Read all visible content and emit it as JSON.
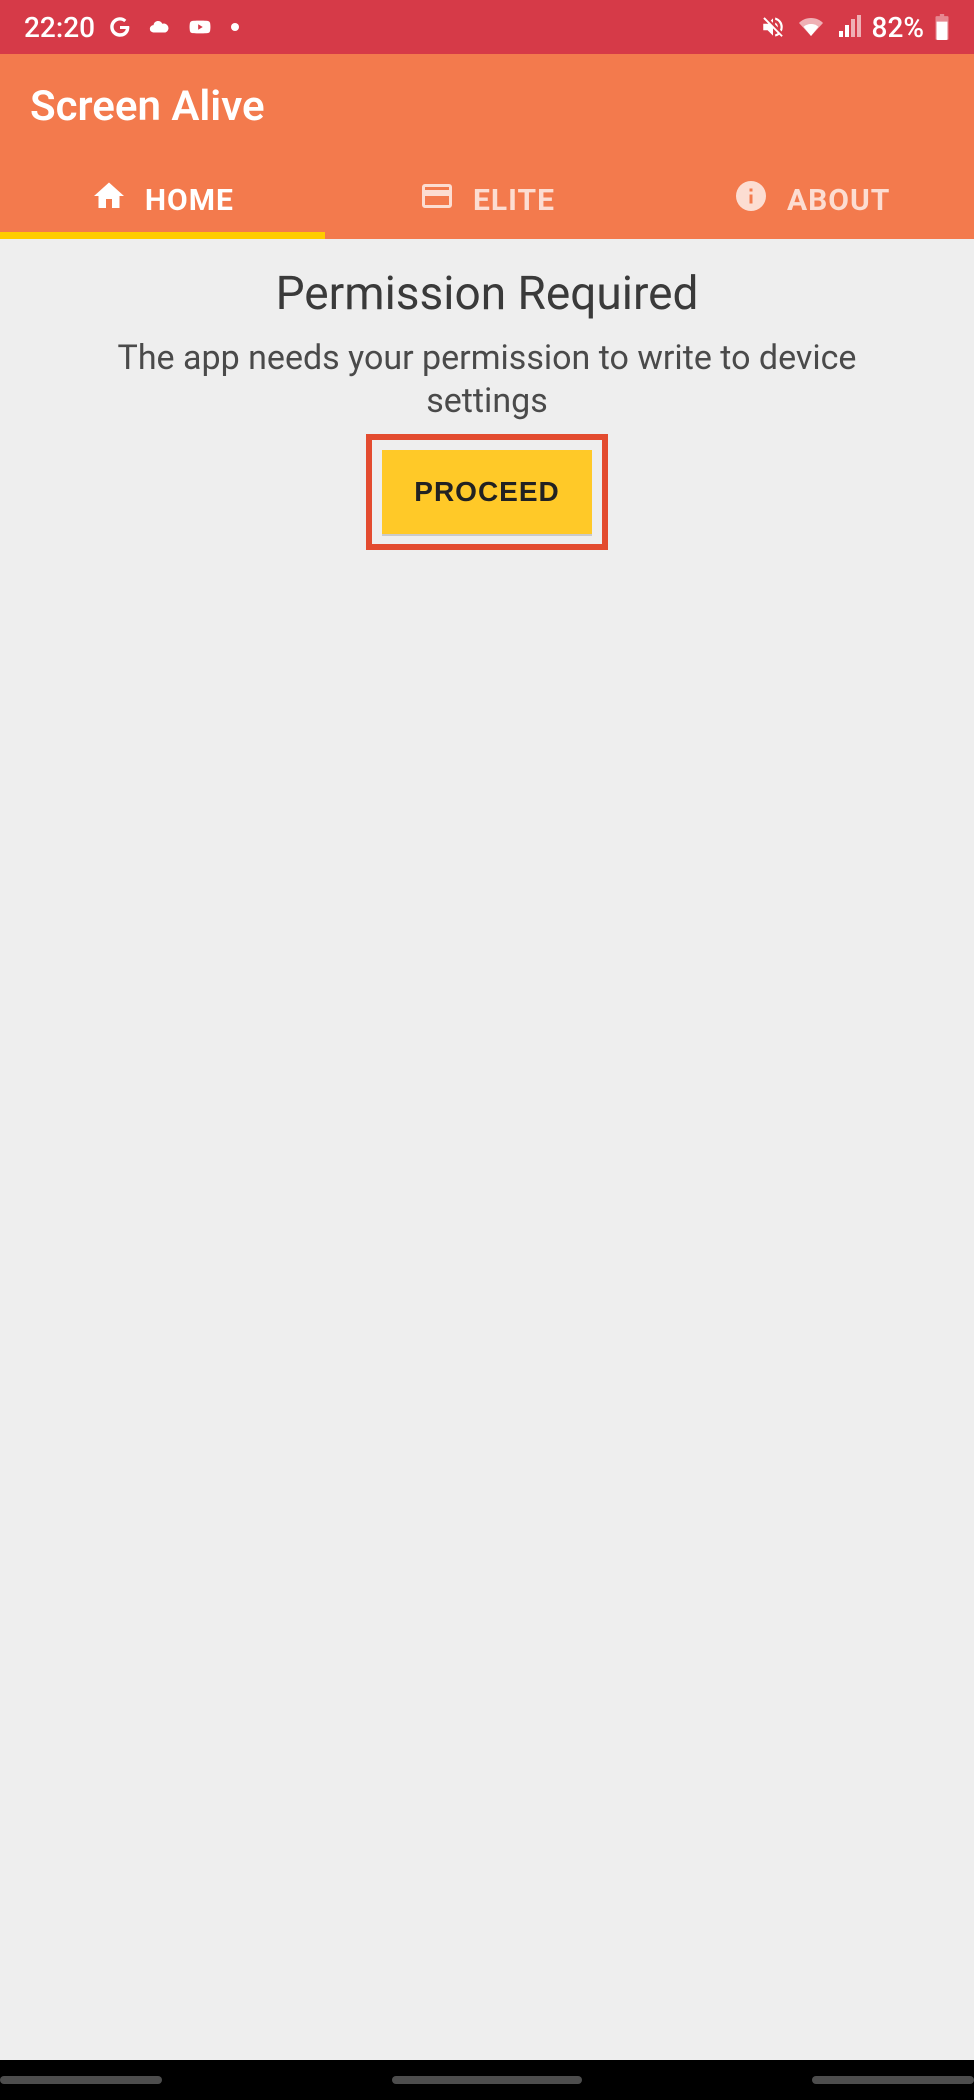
{
  "status": {
    "time": "22:20",
    "battery": "82%"
  },
  "app": {
    "title": "Screen Alive"
  },
  "tabs": [
    {
      "label": "HOME",
      "icon": "home-icon",
      "active": true
    },
    {
      "label": "ELITE",
      "icon": "card-icon",
      "active": false
    },
    {
      "label": "ABOUT",
      "icon": "info-icon",
      "active": false
    }
  ],
  "content": {
    "title": "Permission Required",
    "description": "The app needs your permission to write to device settings",
    "proceed_label": "PROCEED"
  }
}
